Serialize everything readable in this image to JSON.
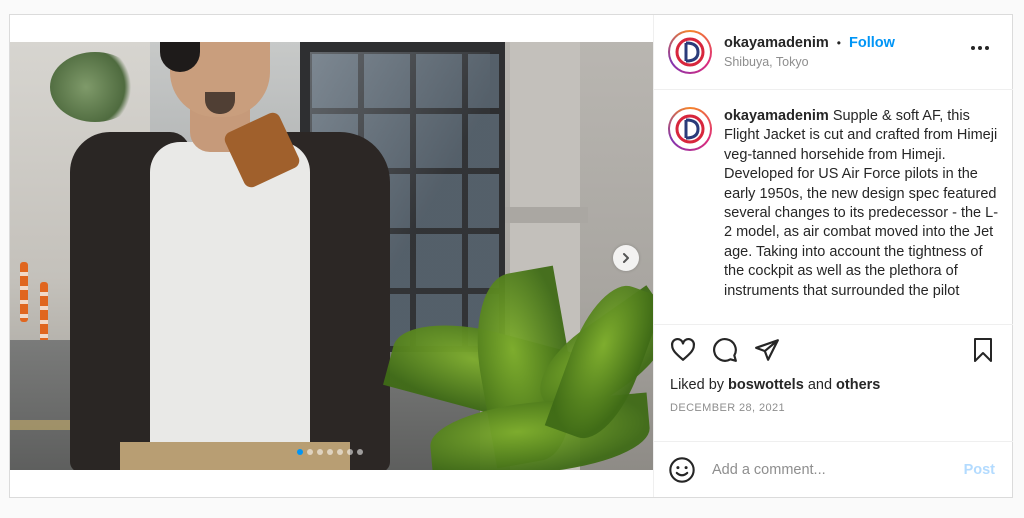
{
  "post": {
    "media": {
      "carousel_dots": 7,
      "active_dot": 0,
      "next_icon": "chevron-right-icon"
    },
    "header": {
      "username": "okayamadenim",
      "separator": "•",
      "follow_label": "Follow",
      "location": "Shibuya, Tokyo",
      "more_icon": "ellipsis-icon",
      "avatar_icon": "od-logo"
    },
    "caption": {
      "username": "okayamadenim",
      "text": "Supple & soft AF, this Flight Jacket is cut and crafted from Himeji veg-tanned horsehide from Himeji. Developed for US Air Force pilots in the early 1950s, the new design spec featured several changes to its predecessor - the L-2 model, as air combat moved into the Jet age. Taking into account the tightness of the cockpit as well as the plethora of instruments that surrounded the pilot"
    },
    "actions": {
      "like_icon": "heart-icon",
      "comment_icon": "comment-icon",
      "share_icon": "paper-plane-icon",
      "save_icon": "bookmark-icon"
    },
    "likes": {
      "prefix": "Liked by",
      "user": "boswottels",
      "joiner": "and",
      "others": "others"
    },
    "date": "DECEMBER 28, 2021",
    "comment": {
      "emoji_icon": "smiley-icon",
      "placeholder": "Add a comment...",
      "post_label": "Post"
    },
    "colors": {
      "accent": "#0095f6",
      "post_disabled": "#b3dbff",
      "muted": "#8e8e8e",
      "text": "#262626"
    }
  }
}
